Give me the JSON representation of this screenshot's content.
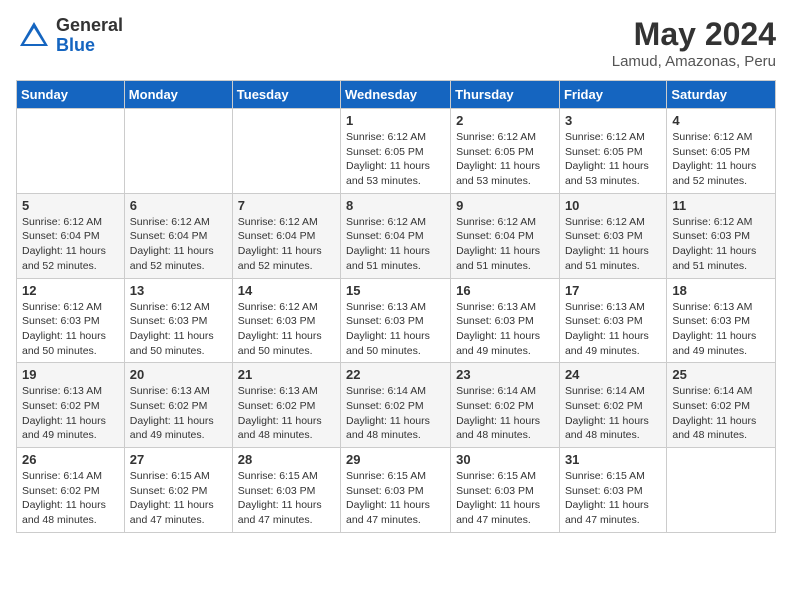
{
  "logo": {
    "general": "General",
    "blue": "Blue"
  },
  "title": "May 2024",
  "location": "Lamud, Amazonas, Peru",
  "days_of_week": [
    "Sunday",
    "Monday",
    "Tuesday",
    "Wednesday",
    "Thursday",
    "Friday",
    "Saturday"
  ],
  "weeks": [
    [
      {
        "num": "",
        "info": ""
      },
      {
        "num": "",
        "info": ""
      },
      {
        "num": "",
        "info": ""
      },
      {
        "num": "1",
        "info": "Sunrise: 6:12 AM\nSunset: 6:05 PM\nDaylight: 11 hours and 53 minutes."
      },
      {
        "num": "2",
        "info": "Sunrise: 6:12 AM\nSunset: 6:05 PM\nDaylight: 11 hours and 53 minutes."
      },
      {
        "num": "3",
        "info": "Sunrise: 6:12 AM\nSunset: 6:05 PM\nDaylight: 11 hours and 53 minutes."
      },
      {
        "num": "4",
        "info": "Sunrise: 6:12 AM\nSunset: 6:05 PM\nDaylight: 11 hours and 52 minutes."
      }
    ],
    [
      {
        "num": "5",
        "info": "Sunrise: 6:12 AM\nSunset: 6:04 PM\nDaylight: 11 hours and 52 minutes."
      },
      {
        "num": "6",
        "info": "Sunrise: 6:12 AM\nSunset: 6:04 PM\nDaylight: 11 hours and 52 minutes."
      },
      {
        "num": "7",
        "info": "Sunrise: 6:12 AM\nSunset: 6:04 PM\nDaylight: 11 hours and 52 minutes."
      },
      {
        "num": "8",
        "info": "Sunrise: 6:12 AM\nSunset: 6:04 PM\nDaylight: 11 hours and 51 minutes."
      },
      {
        "num": "9",
        "info": "Sunrise: 6:12 AM\nSunset: 6:04 PM\nDaylight: 11 hours and 51 minutes."
      },
      {
        "num": "10",
        "info": "Sunrise: 6:12 AM\nSunset: 6:03 PM\nDaylight: 11 hours and 51 minutes."
      },
      {
        "num": "11",
        "info": "Sunrise: 6:12 AM\nSunset: 6:03 PM\nDaylight: 11 hours and 51 minutes."
      }
    ],
    [
      {
        "num": "12",
        "info": "Sunrise: 6:12 AM\nSunset: 6:03 PM\nDaylight: 11 hours and 50 minutes."
      },
      {
        "num": "13",
        "info": "Sunrise: 6:12 AM\nSunset: 6:03 PM\nDaylight: 11 hours and 50 minutes."
      },
      {
        "num": "14",
        "info": "Sunrise: 6:12 AM\nSunset: 6:03 PM\nDaylight: 11 hours and 50 minutes."
      },
      {
        "num": "15",
        "info": "Sunrise: 6:13 AM\nSunset: 6:03 PM\nDaylight: 11 hours and 50 minutes."
      },
      {
        "num": "16",
        "info": "Sunrise: 6:13 AM\nSunset: 6:03 PM\nDaylight: 11 hours and 49 minutes."
      },
      {
        "num": "17",
        "info": "Sunrise: 6:13 AM\nSunset: 6:03 PM\nDaylight: 11 hours and 49 minutes."
      },
      {
        "num": "18",
        "info": "Sunrise: 6:13 AM\nSunset: 6:03 PM\nDaylight: 11 hours and 49 minutes."
      }
    ],
    [
      {
        "num": "19",
        "info": "Sunrise: 6:13 AM\nSunset: 6:02 PM\nDaylight: 11 hours and 49 minutes."
      },
      {
        "num": "20",
        "info": "Sunrise: 6:13 AM\nSunset: 6:02 PM\nDaylight: 11 hours and 49 minutes."
      },
      {
        "num": "21",
        "info": "Sunrise: 6:13 AM\nSunset: 6:02 PM\nDaylight: 11 hours and 48 minutes."
      },
      {
        "num": "22",
        "info": "Sunrise: 6:14 AM\nSunset: 6:02 PM\nDaylight: 11 hours and 48 minutes."
      },
      {
        "num": "23",
        "info": "Sunrise: 6:14 AM\nSunset: 6:02 PM\nDaylight: 11 hours and 48 minutes."
      },
      {
        "num": "24",
        "info": "Sunrise: 6:14 AM\nSunset: 6:02 PM\nDaylight: 11 hours and 48 minutes."
      },
      {
        "num": "25",
        "info": "Sunrise: 6:14 AM\nSunset: 6:02 PM\nDaylight: 11 hours and 48 minutes."
      }
    ],
    [
      {
        "num": "26",
        "info": "Sunrise: 6:14 AM\nSunset: 6:02 PM\nDaylight: 11 hours and 48 minutes."
      },
      {
        "num": "27",
        "info": "Sunrise: 6:15 AM\nSunset: 6:02 PM\nDaylight: 11 hours and 47 minutes."
      },
      {
        "num": "28",
        "info": "Sunrise: 6:15 AM\nSunset: 6:03 PM\nDaylight: 11 hours and 47 minutes."
      },
      {
        "num": "29",
        "info": "Sunrise: 6:15 AM\nSunset: 6:03 PM\nDaylight: 11 hours and 47 minutes."
      },
      {
        "num": "30",
        "info": "Sunrise: 6:15 AM\nSunset: 6:03 PM\nDaylight: 11 hours and 47 minutes."
      },
      {
        "num": "31",
        "info": "Sunrise: 6:15 AM\nSunset: 6:03 PM\nDaylight: 11 hours and 47 minutes."
      },
      {
        "num": "",
        "info": ""
      }
    ]
  ]
}
